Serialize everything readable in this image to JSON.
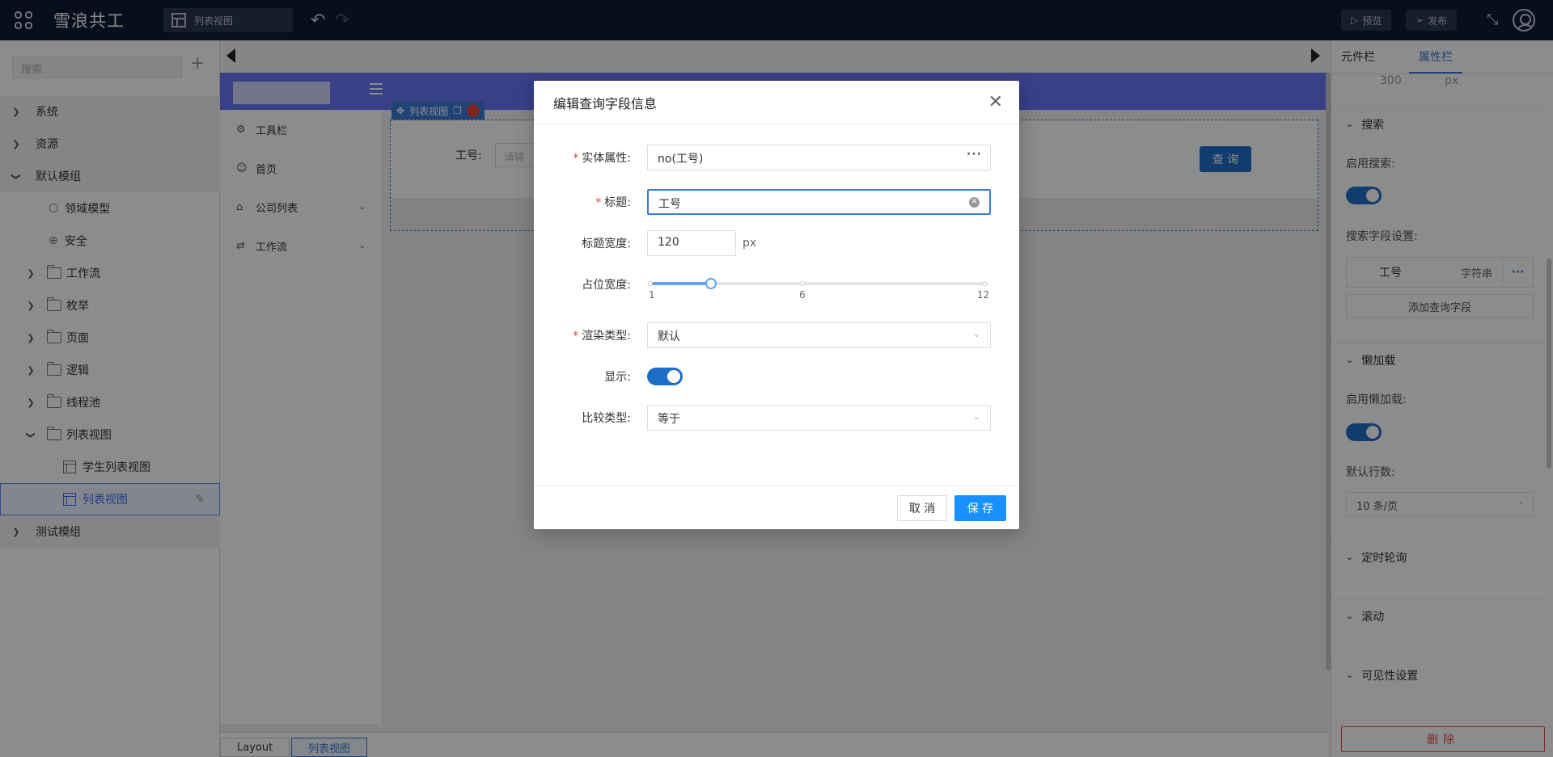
{
  "app": {
    "title": "雪浪共工",
    "current_view": "列表视图"
  },
  "toolbar": {
    "preview": "预览",
    "publish": "发布"
  },
  "sidebar": {
    "search_placeholder": "搜索",
    "tree": [
      {
        "label": "系统"
      },
      {
        "label": "资源"
      },
      {
        "label": "默认模组"
      },
      {
        "label": "领域模型"
      },
      {
        "label": "安全"
      },
      {
        "label": "工作流"
      },
      {
        "label": "枚举"
      },
      {
        "label": "页面"
      },
      {
        "label": "逻辑"
      },
      {
        "label": "线程池"
      },
      {
        "label": "列表视图"
      },
      {
        "label": "学生列表视图"
      },
      {
        "label": "列表视图"
      },
      {
        "label": "测试模组"
      }
    ]
  },
  "canvas": {
    "menu": [
      {
        "label": "工具栏"
      },
      {
        "label": "首页"
      },
      {
        "label": "公司列表"
      },
      {
        "label": "工作流"
      }
    ],
    "component_tag": "列表视图",
    "search_label": "工号:",
    "search_placeholder": "请输",
    "query_button": "查 询",
    "breadcrumb": [
      "Layout",
      "列表视图"
    ]
  },
  "right_panel": {
    "tabs": [
      "元件栏",
      "属性栏"
    ],
    "top_partial_value": "300",
    "top_partial_unit": "px",
    "search_section": "搜索",
    "enable_search_label": "启用搜索:",
    "search_fields_label": "搜索字段设置:",
    "search_field": {
      "name": "工号",
      "type": "字符串"
    },
    "add_query_field": "添加查询字段",
    "lazy_section": "懒加载",
    "enable_lazy_label": "启用懒加载:",
    "default_rows_label": "默认行数:",
    "default_rows_value": "10 条/页",
    "poll_section": "定时轮询",
    "scroll_section": "滚动",
    "visibility_section": "可见性设置",
    "delete_button": "删除"
  },
  "modal": {
    "title": "编辑查询字段信息",
    "fields": {
      "entity_attr_label": "实体属性:",
      "entity_attr_value": "no(工号)",
      "title_label": "标题:",
      "title_value": "工号",
      "title_width_label": "标题宽度:",
      "title_width_value": "120",
      "title_width_unit": "px",
      "span_label": "占位宽度:",
      "span_min": "1",
      "span_mid": "6",
      "span_max": "12",
      "span_value": 3,
      "render_type_label": "渲染类型:",
      "render_type_value": "默认",
      "display_label": "显示:",
      "display_on": true,
      "compare_label": "比较类型:",
      "compare_value": "等于"
    },
    "cancel": "取 消",
    "save": "保 存"
  },
  "colors": {
    "primary": "#1890ff",
    "topbar": "#0e1a33",
    "header": "#6675f7",
    "danger": "#e64545"
  }
}
